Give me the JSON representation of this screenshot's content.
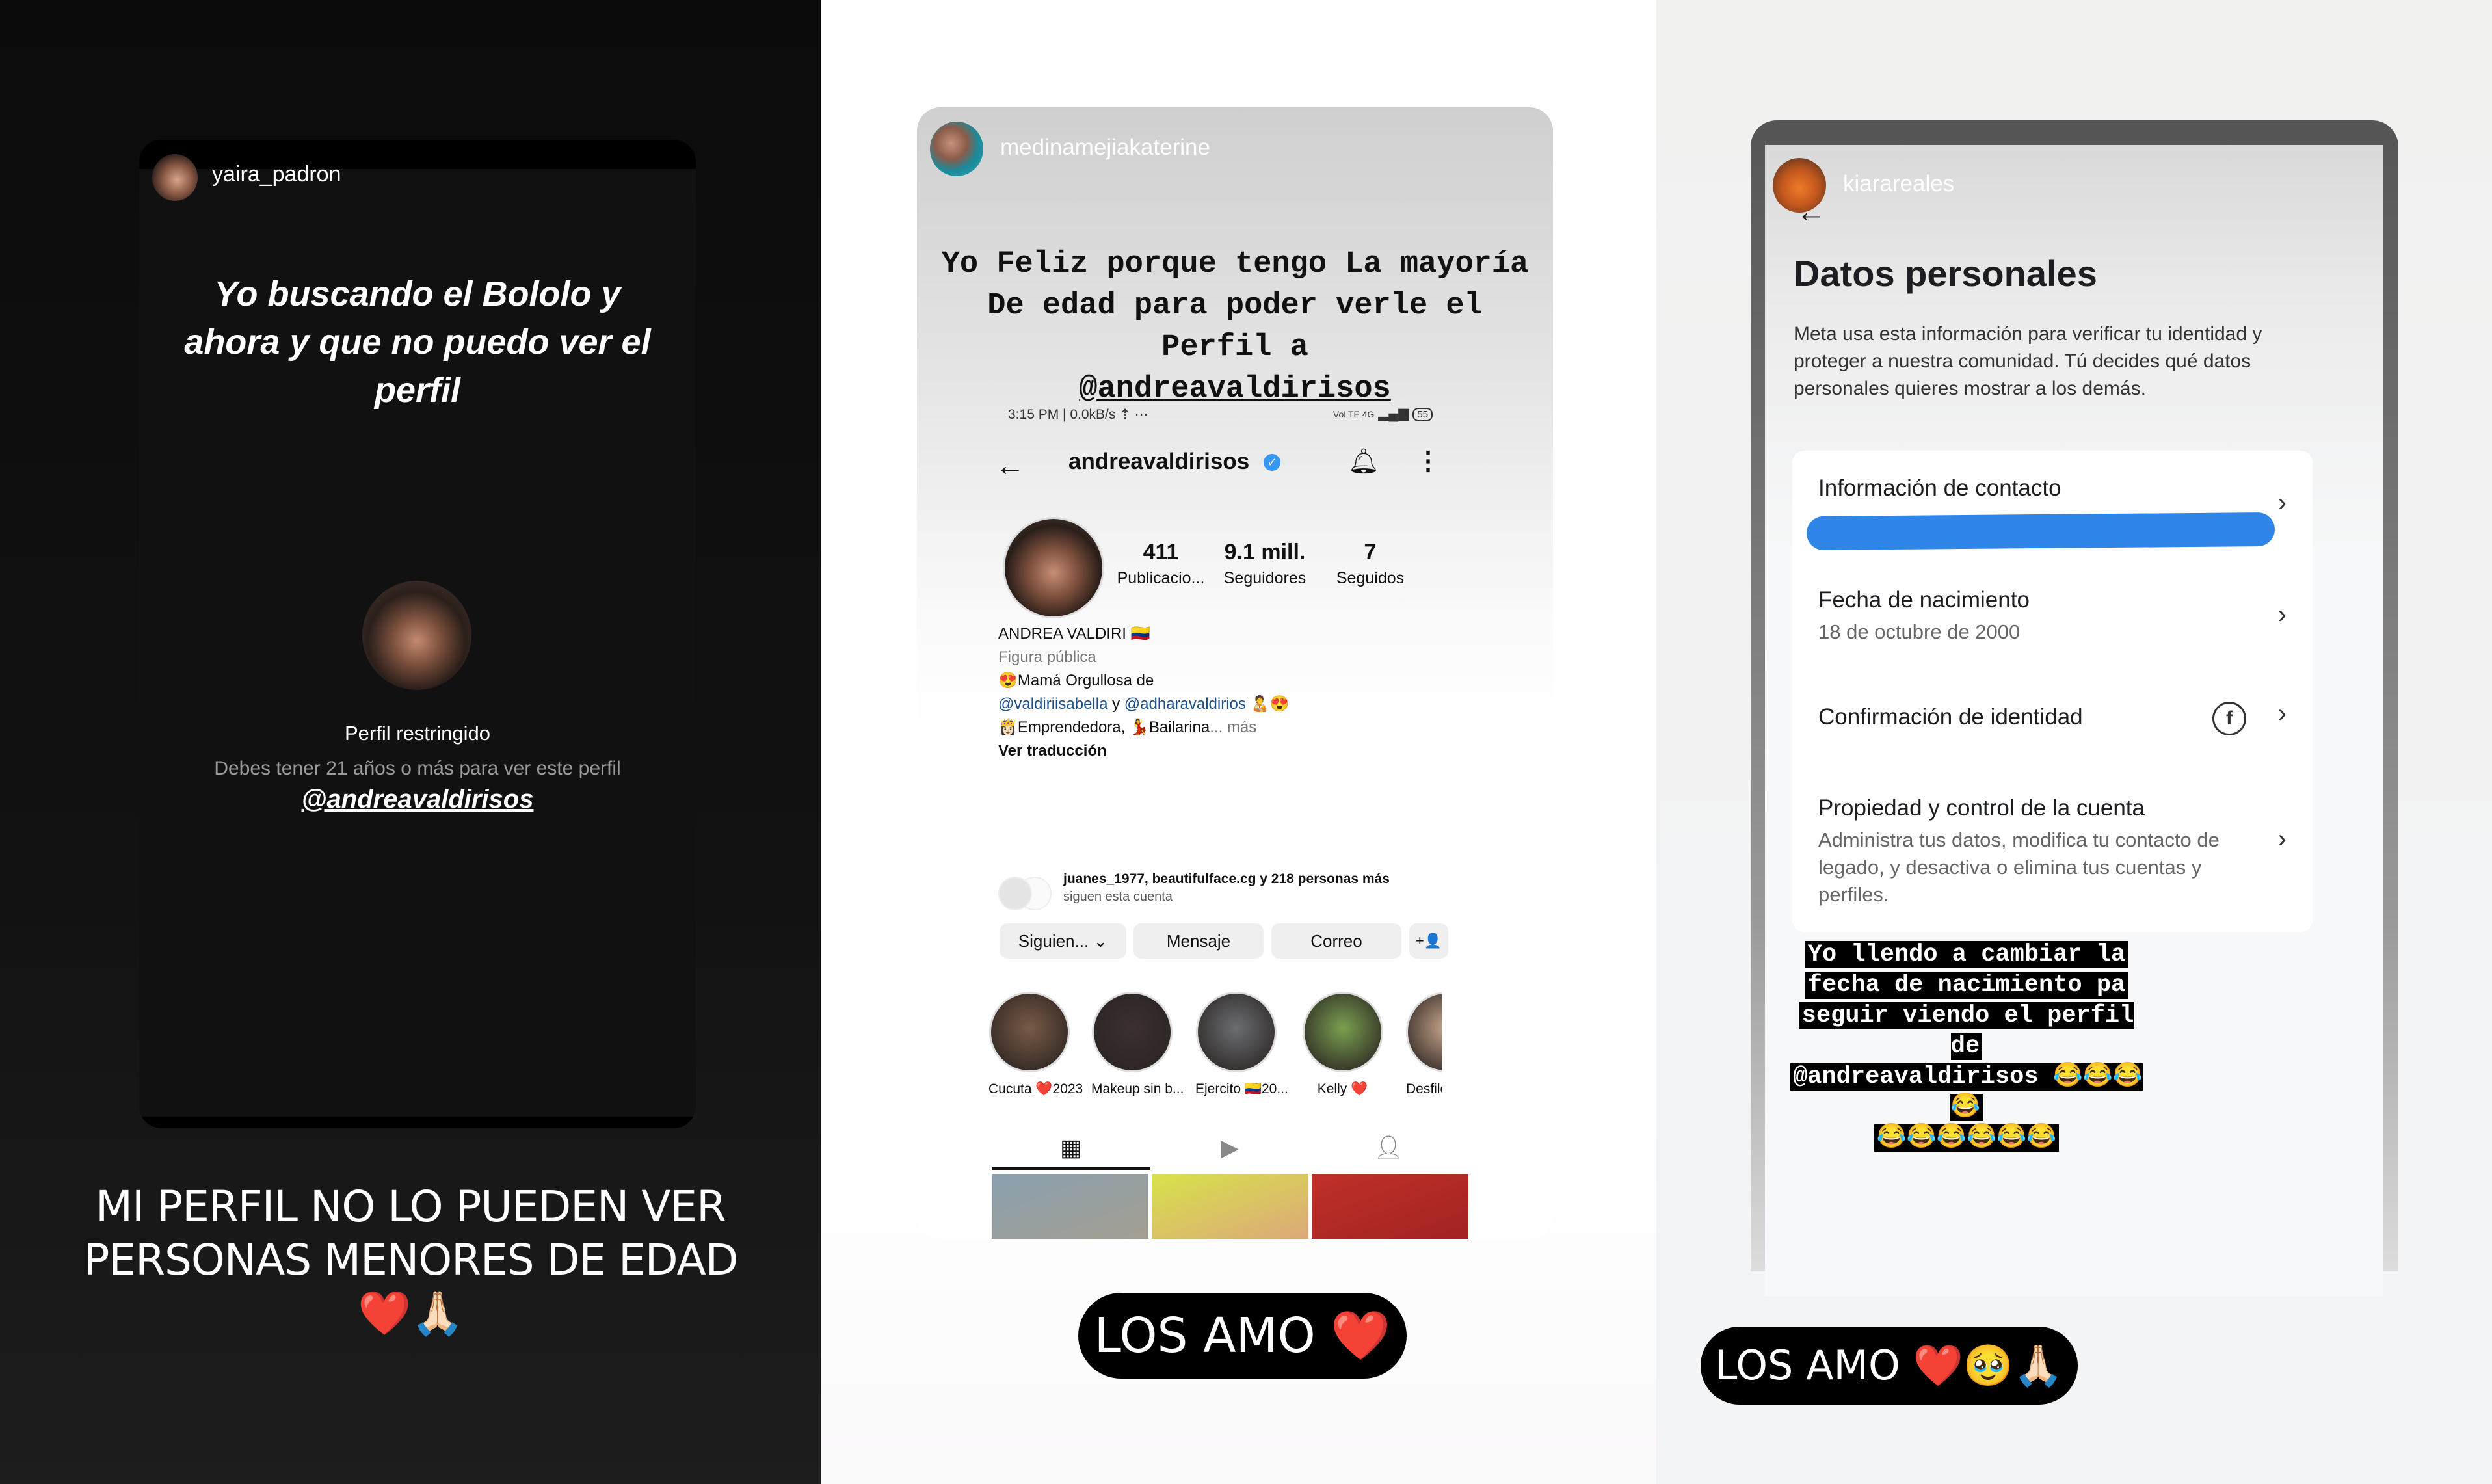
{
  "panels": {
    "left": {
      "username": "yaira_padron",
      "headline": "Yo buscando el Bololo y ahora y que no puedo ver el perfil",
      "restricted_title": "Perfil restringido",
      "restricted_subtitle": "Debes tener 21 años o más para ver este perfil",
      "mention": "@andreavaldirisos",
      "caption": "MI PERFIL NO LO PUEDEN VER PERSONAS MENORES DE EDAD ❤️🙏🏻"
    },
    "middle": {
      "username": "medinamejiakaterine",
      "headline_text": "Yo Feliz porque tengo La mayoría De edad para poder verle el Perfil a",
      "headline_mention": "@andreavaldirisos",
      "status_bar": {
        "time": "3:15 PM | 0.0kB/s",
        "icons": "⋯",
        "network": "VoLTE 4G",
        "battery": "55"
      },
      "profile": {
        "handle": "andreavaldirisos",
        "verified": true,
        "stats": [
          {
            "value": "411",
            "label": "Publicacio..."
          },
          {
            "value": "9.1 mill.",
            "label": "Seguidores"
          },
          {
            "value": "7",
            "label": "Seguidos"
          }
        ],
        "name": "ANDREA VALDIRI 🇨🇴",
        "category": "Figura pública",
        "bio_line1": "😍Mamá Orgullosa de",
        "bio_link1": "@valdiriisabella",
        "bio_and": " y ",
        "bio_link2": "@adharavaldirios",
        "bio_emoji": " 🧑‍🍼😍",
        "bio_line3": "👸🏻Emprendedora, 💃Bailarina",
        "bio_more": "... más",
        "translate": "Ver traducción",
        "followed_by": "juanes_1977, beautifulface.cg y 218 personas más",
        "followed_by_sub": "siguen esta cuenta",
        "buttons": {
          "following": "Siguien... ⌄",
          "message": "Mensaje",
          "email": "Correo",
          "add_user": "+👤"
        },
        "highlights": [
          {
            "label": "Cucuta ❤️2023",
            "color": "#7a5a46"
          },
          {
            "label": "Makeup sin b...",
            "color": "#3a3030"
          },
          {
            "label": "Ejercito 🇨🇴20...",
            "color": "#6b6e72"
          },
          {
            "label": "Kelly ❤️",
            "color": "#7aa050"
          },
          {
            "label": "Desfile",
            "color": "#c9a58a"
          }
        ],
        "tabs": [
          "grid",
          "reels",
          "tagged"
        ],
        "posts": [
          {
            "color_a": "#8aa0b0",
            "color_b": "#b89e78"
          },
          {
            "color_a": "#d7e24a",
            "color_b": "#e07aa0"
          },
          {
            "color_a": "#c0302a",
            "color_b": "#8a1a18"
          }
        ]
      },
      "caption": "LOS AMO ❤️"
    },
    "right": {
      "username": "kiarareales",
      "title": "Datos personales",
      "description": "Meta usa esta información para verificar tu identidad y proteger a nuestra comunidad. Tú decides qué datos personales quieres mostrar a los demás.",
      "rows": [
        {
          "title": "Información de contacto",
          "subtitle": "[redacted]"
        },
        {
          "title": "Fecha de nacimiento",
          "subtitle": "18 de octubre de 2000"
        },
        {
          "title": "Confirmación de identidad",
          "subtitle": ""
        },
        {
          "title": "Propiedad y control de la cuenta",
          "subtitle": "Administra tus datos, modifica tu contacto de legado, y desactiva o elimina tus cuentas y perfiles."
        }
      ],
      "overlay_lines": [
        "Yo llendo a cambiar la",
        "fecha de nacimiento pa",
        "seguir viendo el perfil de",
        "@andreavaldirisos 😂😂😂😂",
        "😂😂😂😂😂😂"
      ],
      "caption": "LOS AMO ❤️🥹🙏🏻",
      "redaction_color": "#2f86e8"
    }
  }
}
